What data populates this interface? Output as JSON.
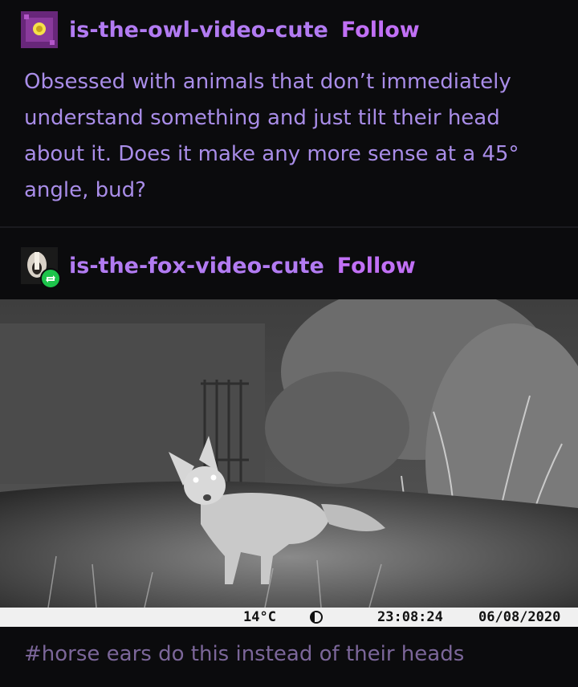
{
  "post1": {
    "username": "is-the-owl-video-cute",
    "follow_label": "Follow",
    "body": "Obsessed with animals that don’t immediately understand something and just tilt their head about it. Does it make any more sense at a 45° angle, bud?"
  },
  "post2": {
    "username": "is-the-fox-video-cute",
    "follow_label": "Follow",
    "camera": {
      "temperature": "14°C",
      "time": "23:08:24",
      "date": "06/08/2020"
    },
    "tag": "#horse ears do this instead of their heads"
  },
  "colors": {
    "background": "#0b0b0d",
    "username": "#b27bf2",
    "follow": "#c170f5",
    "body_text": "#a98de8",
    "tag_text": "#7b6699",
    "reblog_badge": "#1dc44b"
  },
  "icons": {
    "post1_avatar": "owl-avatar-icon",
    "post2_avatar": "fox-avatar-icon",
    "reblog": "reblog-icon"
  }
}
